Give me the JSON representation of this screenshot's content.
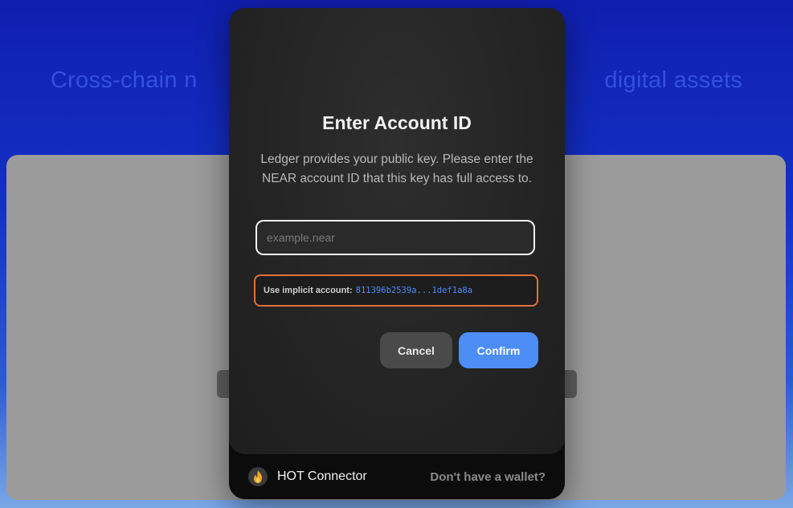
{
  "background": {
    "hero_title_left": "Cross-chain n",
    "hero_title_right": "digital assets"
  },
  "modal": {
    "title": "Enter Account ID",
    "description": "Ledger provides your public key. Please enter the NEAR account ID that this key has full access to.",
    "input": {
      "value": "",
      "placeholder": "example.near"
    },
    "implicit": {
      "label": "Use implicit account:",
      "value": "811396b2539a...1def1a8a"
    },
    "buttons": {
      "cancel": "Cancel",
      "confirm": "Confirm"
    },
    "footer": {
      "brand_label": "HOT Connector",
      "brand_icon": "hot-flame-icon",
      "link": "Don't have a wallet?"
    }
  },
  "colors": {
    "accent": "#4d8ef6",
    "highlight_border": "#e0703a",
    "modal_bg": "#262626"
  }
}
